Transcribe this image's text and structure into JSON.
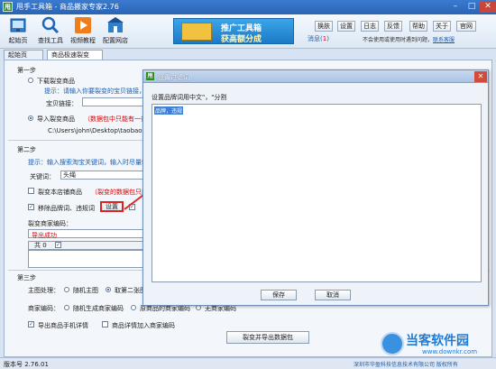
{
  "window": {
    "title": "甩手工具箱 - 商品搬家专家2.76",
    "app_icon_char": "甩",
    "minimize": "–",
    "maximize": "□",
    "close": "✕"
  },
  "toolbar": {
    "items": [
      {
        "label": "起始页",
        "icon": "home-icon"
      },
      {
        "label": "查找工具",
        "icon": "search-icon"
      },
      {
        "label": "视频教程",
        "icon": "video-icon"
      },
      {
        "label": "配置网店",
        "icon": "shop-icon"
      }
    ],
    "banner_line1": "推广工具箱",
    "banner_line2": "获高额分成",
    "top_buttons": [
      "换肤",
      "设置",
      "日志",
      "反馈",
      "帮助",
      "关于",
      "官网"
    ],
    "message_label": "消息(",
    "message_count": "1",
    "message_close": ")",
    "notice": "不会使用或使用时遇到问题，",
    "notice_link": "联系客服"
  },
  "tabs": [
    {
      "label": "起始页",
      "active": false
    },
    {
      "label": "商品极速裂变",
      "active": true
    }
  ],
  "step1": {
    "title": "第一步",
    "option_download": "下载裂变商品",
    "hint_download": "提示：请输入你要裂变的宝贝链接，",
    "url_label": "宝贝链接：",
    "option_import": "导入裂变商品",
    "import_note": "（数据包中只能有一条",
    "path": "C:\\Users\\john\\Desktop\\taobao zhu"
  },
  "step2": {
    "title": "第二步",
    "hint": "提示：输入搜索淘宝关键词，输入时尽量输",
    "keyword_label": "关键词：",
    "keyword_value": "头绳",
    "store_check": "裂变本店铺商品",
    "store_note": "（裂变的数据包只能",
    "remove_words": "移除品牌词、违规词",
    "settings_button": "设置",
    "merchant_code_label": "裂变商家编码：",
    "export_success": "导出成功",
    "table_header_count": "共 0"
  },
  "step3": {
    "title": "第三步",
    "main_image_label": "主图处理：",
    "opt_random_main": "随机主图",
    "opt_second_main": "取第二张图",
    "merchant_code_label": "商家编码：",
    "opt_random_code": "随机生成商家编码",
    "opt_original_code": "原商品的商家编码",
    "opt_no_code": "无商家编码",
    "export_mobile": "导出商品手机详情",
    "add_to_detail": "商品详情加入商家编码",
    "export_button": "裂变并导出数据包"
  },
  "dialog": {
    "title": "设置过滤词",
    "prompt": "设置品牌词用中文\"，\"分割",
    "selected_text": "品牌，违规",
    "save_button": "保存",
    "cancel_button": "取消",
    "close": "✕"
  },
  "status": {
    "version": "版本号 2.76.01",
    "company": "深圳市华盈科技信息技术有限公司 版权所有"
  },
  "watermark": {
    "name": "当客软件园",
    "url": "www.downkr.com"
  },
  "colors": {
    "titlebar": "#2a63b4",
    "link_blue": "#1a5fb4",
    "warning_red": "#d00000",
    "highlight_border": "#e02020"
  }
}
